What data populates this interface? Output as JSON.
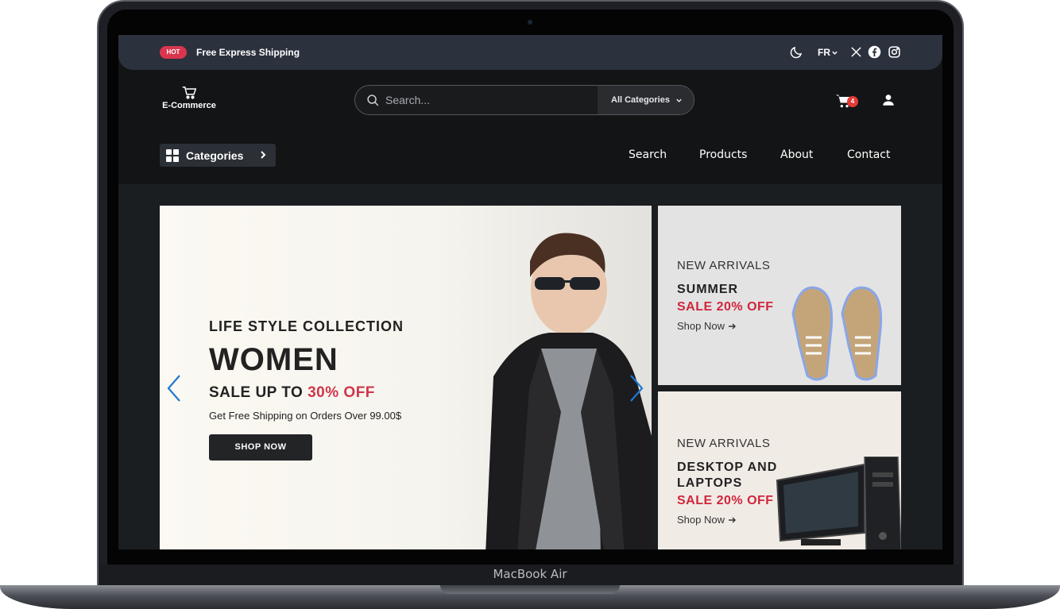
{
  "topbar": {
    "hot_badge": "HOT",
    "shipping_text": "Free Express Shipping",
    "language": "FR"
  },
  "header": {
    "logo_text": "E-Commerce",
    "search_placeholder": "Search...",
    "category_select": "All Categories",
    "cart_count": "4"
  },
  "nav": {
    "categories_label": "Categories",
    "links": [
      "Search",
      "Products",
      "About",
      "Contact"
    ]
  },
  "hero": {
    "subtitle": "LIFE STYLE COLLECTION",
    "title": "WOMEN",
    "sale_prefix": "SALE UP TO",
    "sale_percent": "30% OFF",
    "shipping_note": "Get Free Shipping on Orders Over 99.00$",
    "button_label": "SHOP NOW"
  },
  "promos": [
    {
      "kicker": "NEW ARRIVALS",
      "title_line1": "SUMMER",
      "sale": "SALE 20% OFF",
      "link": "Shop Now"
    },
    {
      "kicker": "NEW ARRIVALS",
      "title_line1": "DESKTOP AND",
      "title_line2": "LAPTOPS",
      "sale": "SALE 20% OFF",
      "link": "Shop Now"
    }
  ],
  "device": {
    "label": "MacBook Air"
  },
  "colors": {
    "accent_red": "#d0364c",
    "topbar": "#2b313d",
    "page_bg": "#131415",
    "carousel_arrow": "#1f78d1"
  },
  "icons": [
    "cart-icon",
    "moon-icon",
    "x-icon",
    "facebook-icon",
    "instagram-icon",
    "search-icon",
    "user-icon",
    "grid-icon"
  ]
}
